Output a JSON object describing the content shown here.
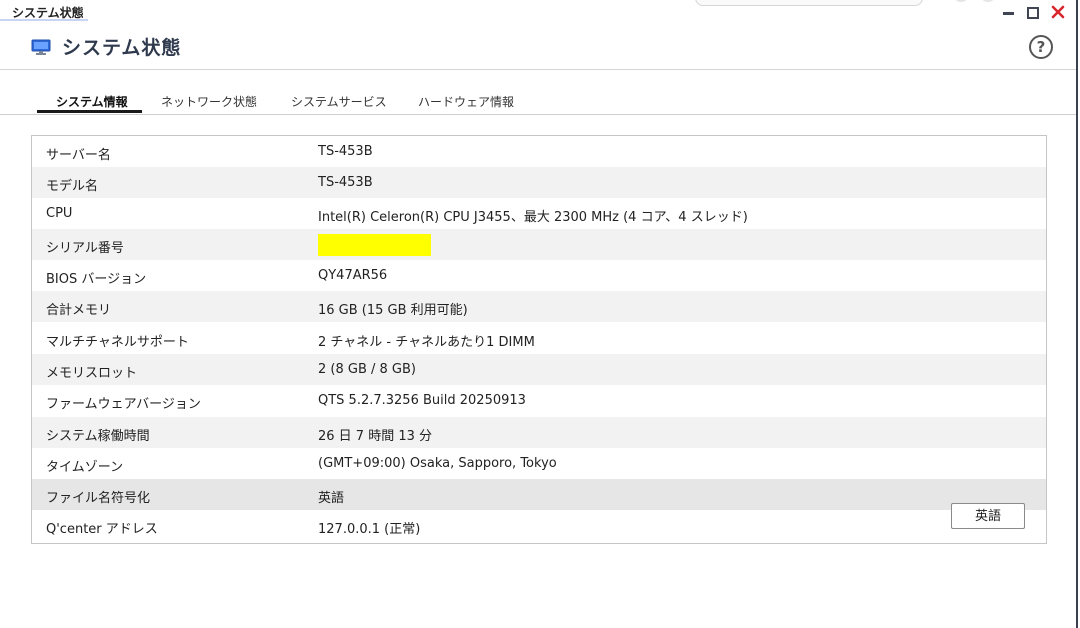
{
  "window": {
    "title": "システム状態"
  },
  "app": {
    "title": "システム状態",
    "help_label": "?"
  },
  "tabs": [
    {
      "label": "システム情報",
      "active": true
    },
    {
      "label": "ネットワーク状態",
      "active": false
    },
    {
      "label": "システムサービス",
      "active": false
    },
    {
      "label": "ハードウェア情報",
      "active": false
    }
  ],
  "system_info": [
    {
      "key": "サーバー名",
      "value": "TS-453B"
    },
    {
      "key": "モデル名",
      "value": "TS-453B"
    },
    {
      "key": "CPU",
      "value": "Intel(R) Celeron(R) CPU J3455、最大 2300 MHz (4 コア、4 スレッド)"
    },
    {
      "key": "シリアル番号",
      "value": ""
    },
    {
      "key": "BIOS バージョン",
      "value": "QY47AR56"
    },
    {
      "key": "合計メモリ",
      "value": "16 GB (15 GB 利用可能)"
    },
    {
      "key": "マルチチャネルサポート",
      "value": "2 チャネル - チャネルあたり1 DIMM"
    },
    {
      "key": "メモリスロット",
      "value": "2 (8 GB / 8 GB)"
    },
    {
      "key": "ファームウェアバージョン",
      "value": "QTS 5.2.7.3256 Build 20250913"
    },
    {
      "key": "システム稼働時間",
      "value": "26 日 7 時間 13 分"
    },
    {
      "key": "タイムゾーン",
      "value": "(GMT+09:00) Osaka, Sapporo, Tokyo"
    },
    {
      "key": "ファイル名符号化",
      "value": "英語"
    },
    {
      "key": "Q'center アドレス",
      "value": "127.0.0.1 (正常)"
    }
  ],
  "encoding_button": {
    "label": "英語"
  },
  "colors": {
    "redaction": "#ffff00",
    "accent_icon": "#2f6bd8"
  }
}
